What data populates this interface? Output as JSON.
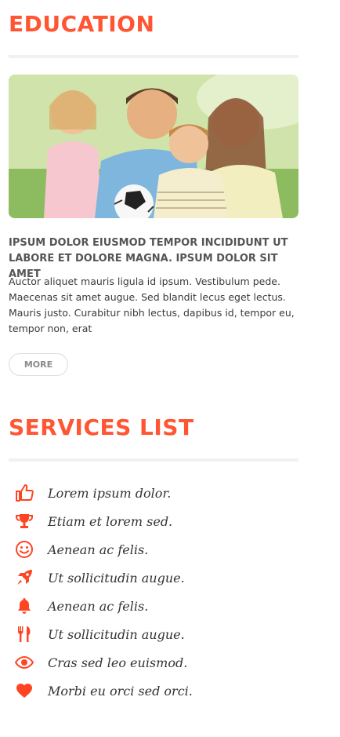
{
  "education": {
    "title": "EDUCATION",
    "headline": "IPSUM DOLOR EIUSMOD TEMPOR INCIDIDUNT UT LABORE ET DOLORE MAGNA. IPSUM DOLOR SIT AMET",
    "body": "Auctor aliquet mauris ligula id ipsum. Vestibulum pede. Maecenas sit amet augue. Sed blandit lecus eget lectus. Mauris justo. Curabitur nibh lectus, dapibus id, tempor eu, tempor non, erat",
    "more_label": "MORE"
  },
  "services": {
    "title": "SERVICES LIST",
    "items": [
      {
        "icon": "thumbs-up-icon",
        "label": "Lorem ipsum dolor."
      },
      {
        "icon": "trophy-icon",
        "label": "Etiam et lorem sed."
      },
      {
        "icon": "smiley-icon",
        "label": "Aenean ac felis."
      },
      {
        "icon": "rocket-icon",
        "label": "Ut sollicitudin augue."
      },
      {
        "icon": "bell-icon",
        "label": "Aenean ac felis."
      },
      {
        "icon": "fork-knife-icon",
        "label": "Ut sollicitudin augue."
      },
      {
        "icon": "eye-icon",
        "label": "Cras sed leo euismod."
      },
      {
        "icon": "heart-icon",
        "label": "Morbi eu orci sed orci."
      }
    ]
  },
  "colors": {
    "accent": "#ff5533",
    "divider": "#f1f1f1",
    "text": "#3a3a3a"
  }
}
